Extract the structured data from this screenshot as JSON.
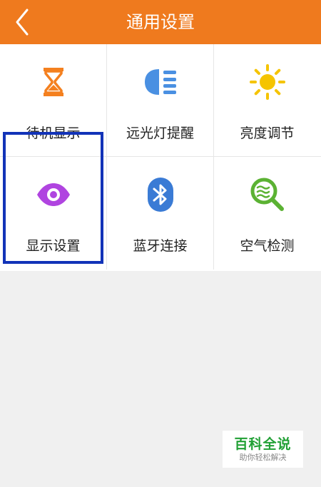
{
  "header": {
    "title": "通用设置",
    "background": "#ef7a1e"
  },
  "grid": {
    "items": [
      {
        "label": "待机显示",
        "icon": "hourglass-icon",
        "color": "#f4801f"
      },
      {
        "label": "远光灯提醒",
        "icon": "headlight-icon",
        "color": "#4a90e2"
      },
      {
        "label": "亮度调节",
        "icon": "sun-icon",
        "color": "#f5c400"
      },
      {
        "label": "显示设置",
        "icon": "eye-icon",
        "color": "#b044e0",
        "selected": true
      },
      {
        "label": "蓝牙连接",
        "icon": "bluetooth-icon",
        "color": "#3a7bd5"
      },
      {
        "label": "空气检测",
        "icon": "air-magnifier-icon",
        "color": "#5bb233"
      }
    ]
  },
  "highlight_color": "#1233b8",
  "watermark": {
    "main": "百科全说",
    "sub": "助你轻松解决"
  }
}
